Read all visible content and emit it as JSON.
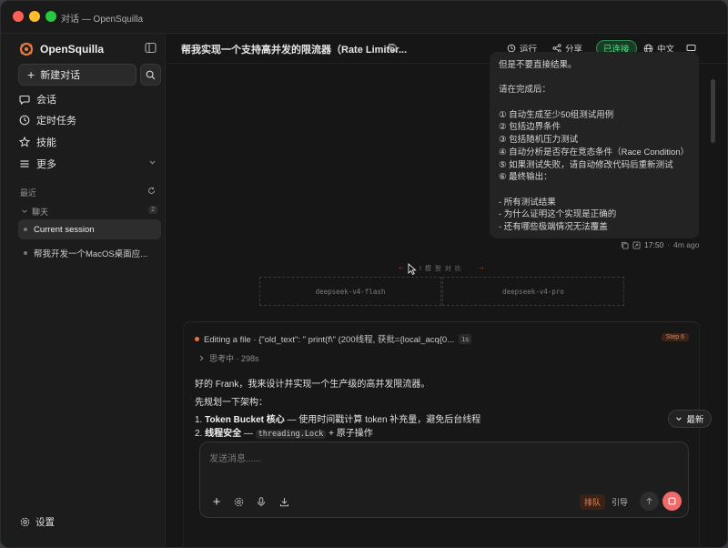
{
  "window": {
    "title": "对话 — OpenSquilla"
  },
  "sidebar": {
    "brand": "OpenSquilla",
    "new_chat": "新建对话",
    "nav": [
      {
        "label": "会话",
        "icon": "chat-bubble-icon"
      },
      {
        "label": "定时任务",
        "icon": "clock-icon"
      },
      {
        "label": "技能",
        "icon": "star-icon"
      },
      {
        "label": "更多",
        "icon": "menu-icon"
      }
    ],
    "recent_label": "最近",
    "group": {
      "label": "聊天",
      "count": "2"
    },
    "sessions": [
      {
        "label": "Current session"
      },
      {
        "label": "帮我开发一个MacOS桌面应..."
      }
    ],
    "settings": "设置"
  },
  "header": {
    "title": "帮我实现一个支持高并发的限流器（Rate Limiter...",
    "run": "运行",
    "share": "分享",
    "connected": "已连接",
    "language": "中文"
  },
  "user_message": {
    "lines": [
      "但是不要直接结果。",
      "",
      "请在完成后：",
      "",
      "① 自动生成至少50组测试用例",
      "② 包括边界条件",
      "③ 包括随机压力测试",
      "④ 自动分析是否存在竞态条件（Race Condition）",
      "⑤ 如果测试失败，请自动修改代码后重新测试",
      "⑥ 最终输出：",
      "",
      "- 所有测试结果",
      "- 为什么证明这个实现是正确的",
      "- 还有哪些极端情况无法覆盖"
    ],
    "time": "17:50",
    "ago": "4m ago"
  },
  "compare": {
    "label": "I 模 型 对 比",
    "left_model": "deepseek-v4-flash",
    "right_model": "deepseek-v4-pro"
  },
  "assistant": {
    "tool_action": "Editing a file · {\"old_text\": \" print(f\\\" (200线程, 获批={local_acq{0...",
    "tool_time": "1s",
    "step": "Step 6",
    "thinking": "思考中 · 298s",
    "intro": "好的 Frank，我来设计并实现一个生产级的高并发限流器。",
    "plan": "先规划一下架构：",
    "items": [
      {
        "num": "1.",
        "bold": "Token Bucket 核心",
        "text": " — 使用时间戳计算 token 补充量，避免后台线程"
      },
      {
        "num": "2.",
        "bold": "线程安全",
        "text": " — ",
        "code": "threading.Lock",
        "tail": " + 原子操作"
      }
    ]
  },
  "latest_button": "最新",
  "composer": {
    "placeholder": "发送消息......",
    "mode_queue": "排队",
    "mode_guide": "引导"
  }
}
